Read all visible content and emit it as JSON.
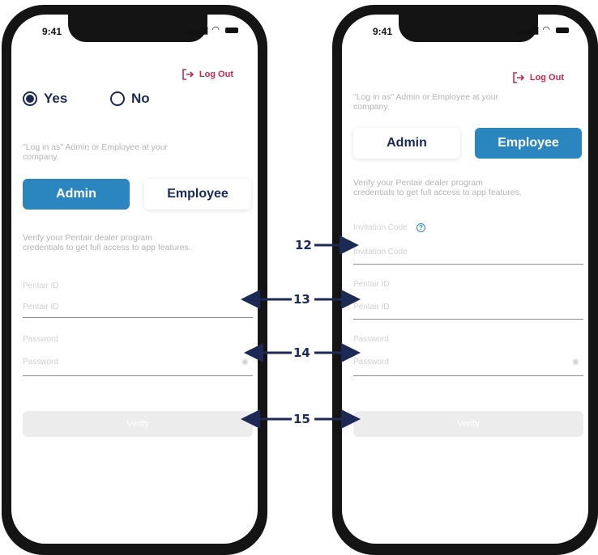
{
  "status_bar": {
    "time": "9:41"
  },
  "logout_label": "Log Out",
  "left_screen": {
    "radio_yes": "Yes",
    "radio_no": "No",
    "hint": "\"Log in as\" Admin or Employee at your company.",
    "admin_label": "Admin",
    "employee_label": "Employee",
    "verify_hint": "Verify your Pentair dealer program credentials to get full access to app features.",
    "pentair_id_label": "Pentair ID",
    "pentair_id_placeholder": "Pentair ID",
    "password_label": "Password",
    "password_placeholder": "Password",
    "verify_button": "Verify"
  },
  "right_screen": {
    "hint": "\"Log in as\" Admin or Employee at your company.",
    "admin_label": "Admin",
    "employee_label": "Employee",
    "verify_hint": "Verify your Pentair dealer program credentials to get full access to app features.",
    "invitation_label": "Invitation Code",
    "invitation_placeholder": "Invitation Code",
    "pentair_id_label": "Pentair ID",
    "pentair_id_placeholder": "Pentair ID",
    "password_label": "Password",
    "password_placeholder": "Password",
    "verify_button": "Verify"
  },
  "callouts": [
    "12",
    "13",
    "14",
    "15"
  ],
  "colors": {
    "primary": "#2b86bf",
    "navy": "#1d2a55",
    "logout": "#c9284b"
  }
}
